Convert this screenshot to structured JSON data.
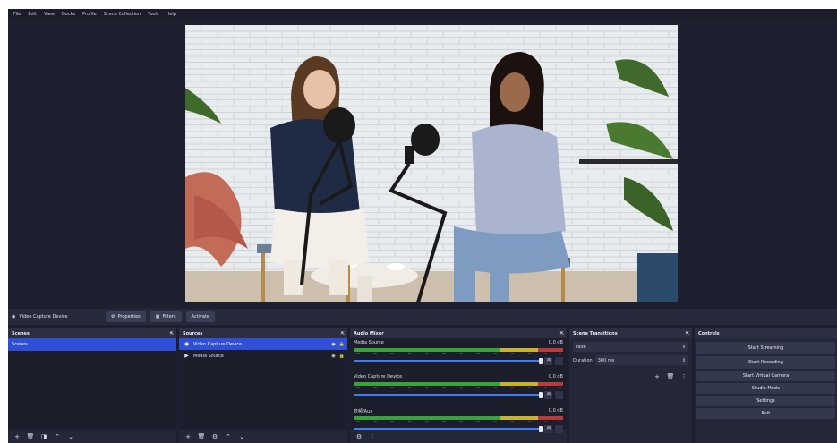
{
  "menu": [
    "File",
    "Edit",
    "View",
    "Docks",
    "Profile",
    "Scene Collection",
    "Tools",
    "Help"
  ],
  "context_bar": {
    "source_name": "Video Capture Device",
    "properties": "Properties",
    "filters": "Filters",
    "activate": "Activate"
  },
  "scenes": {
    "title": "Scenes",
    "items": [
      "Scenes"
    ]
  },
  "sources": {
    "title": "Sources",
    "items": [
      {
        "name": "Video Capture Device",
        "icon": "camera-icon"
      },
      {
        "name": "Media Source",
        "icon": "play-icon"
      }
    ]
  },
  "mixer": {
    "title": "Audio Mixer",
    "channels": [
      {
        "name": "Media Source",
        "db": "0.0 dB",
        "level": 0.7
      },
      {
        "name": "Video Capture Device",
        "db": "0.0 dB",
        "level": 0.7
      },
      {
        "name": "音频/Aux",
        "db": "0.0 dB",
        "level": 0.7
      }
    ],
    "ticks": [
      "-60",
      "-55",
      "-50",
      "-45",
      "-40",
      "-35",
      "-30",
      "-25",
      "-20",
      "-15",
      "-10",
      "-5",
      "0"
    ]
  },
  "transitions": {
    "title": "Scene Transitions",
    "type": "Fade",
    "duration_label": "Duration",
    "duration": "300 ms"
  },
  "controls": {
    "title": "Controls",
    "buttons": [
      "Start Streaming",
      "Start Recording",
      "Start Virtual Camera",
      "Studio Mode",
      "Settings",
      "Exit"
    ]
  },
  "colors": {
    "accent": "#2e4fd6",
    "bg": "#1d1f2e",
    "panel": "#242737"
  }
}
